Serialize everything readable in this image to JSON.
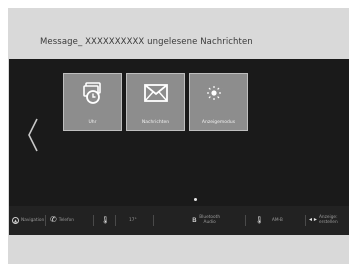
{
  "header": {
    "title": "Message_  XXXXXXXXXX  ungelesene Nachrichten"
  },
  "tiles": [
    {
      "label": "Uhr",
      "icon": "clock-icon"
    },
    {
      "label": "Nachrichten",
      "icon": "envelope-icon"
    },
    {
      "label": "Anzeigemodus",
      "icon": "day-night-icon"
    }
  ],
  "nav": {
    "prev_glyph": "‹"
  },
  "status_bar": {
    "items": [
      {
        "label": "Navigation",
        "icon": "navigation-icon"
      },
      {
        "label": "Telefon",
        "icon": "phone-icon"
      },
      {
        "label": "",
        "icon": "temperature-icon"
      },
      {
        "label": "17°",
        "icon": "temperature-icon"
      },
      {
        "label": "Bluetooth Audio",
        "icon": "bluetooth-icon"
      },
      {
        "label": "AM-B",
        "icon": "fm-icon"
      },
      {
        "label": "Anzeige: erstellen",
        "icon": "display-icon"
      }
    ]
  },
  "colors": {
    "screen_bg": "#1a1a1a",
    "tile_bg": "#8d8d8d",
    "status_bg": "#222222"
  }
}
